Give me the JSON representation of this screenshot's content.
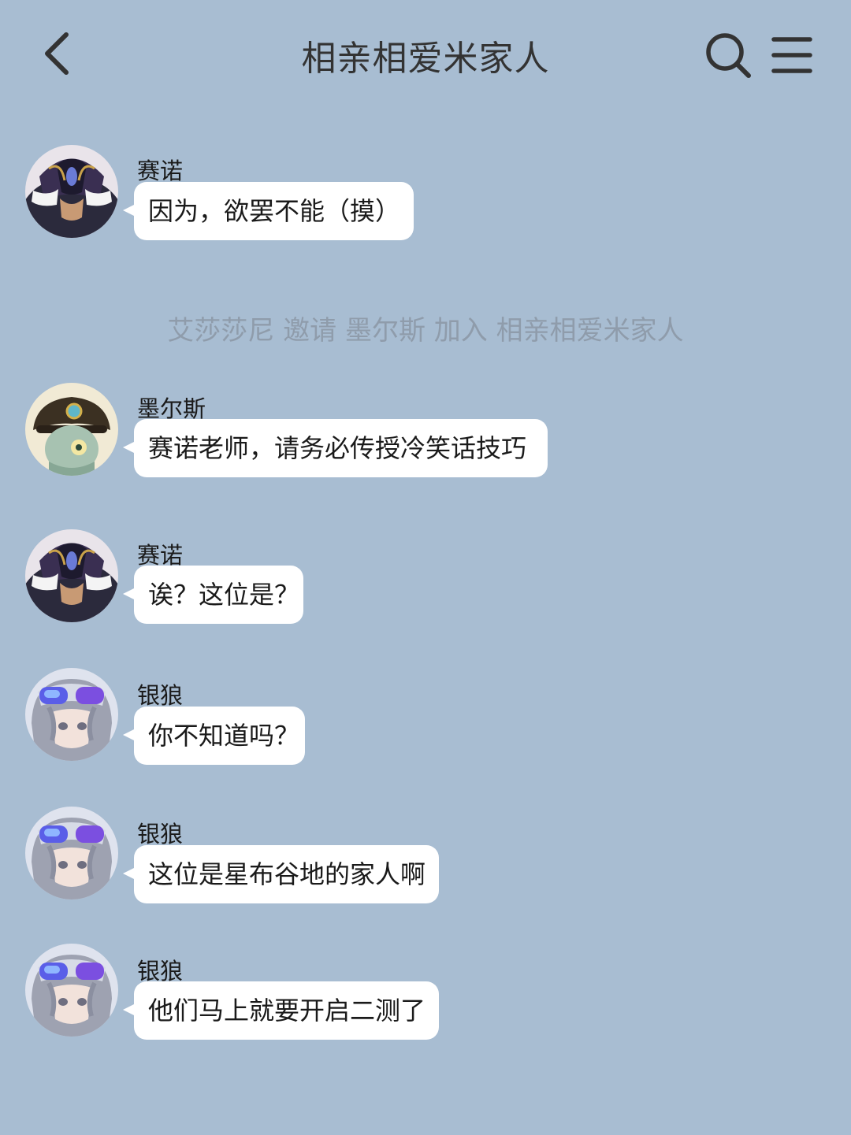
{
  "header": {
    "title": "相亲相爱米家人"
  },
  "system_notice": "艾莎莎尼 邀请 墨尔斯 加入 相亲相爱米家人",
  "messages": [
    {
      "sender": "赛诺",
      "text": "因为，欲罢不能（摸）"
    },
    {
      "sender": "墨尔斯",
      "text": "赛诺老师，请务必传授冷笑话技巧"
    },
    {
      "sender": "赛诺",
      "text": "诶？这位是？"
    },
    {
      "sender": "银狼",
      "text": "你不知道吗？"
    },
    {
      "sender": "银狼",
      "text": "这位是星布谷地的家人啊"
    },
    {
      "sender": "银狼",
      "text": "他们马上就要开启二测了"
    }
  ],
  "colors": {
    "background": "#a8bdd2",
    "bubble": "#ffffff",
    "system_text": "#8f9cab",
    "icon": "#333333"
  },
  "icons": {
    "back": "chevron-left-icon",
    "search": "search-icon",
    "menu": "menu-icon"
  }
}
